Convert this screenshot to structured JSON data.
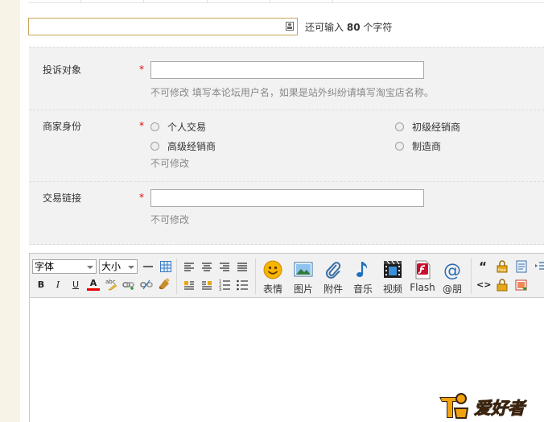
{
  "subject": {
    "value": "",
    "remaining_prefix": "还可输入",
    "remaining_count": "80",
    "remaining_suffix": "个字符"
  },
  "form": {
    "target": {
      "label": "投诉对象",
      "required_mark": "*",
      "value": "",
      "hint": "不可修改   填写本论坛用户名，如果是站外纠纷请填写淘宝店名称。"
    },
    "merchant": {
      "label": "商家身份",
      "required_mark": "*",
      "options": [
        "个人交易",
        "初级经销商",
        "高级经销商",
        "制造商"
      ],
      "hint": "不可修改"
    },
    "link": {
      "label": "交易链接",
      "required_mark": "*",
      "value": "",
      "hint": "不可修改"
    }
  },
  "editor": {
    "font_select": "字体",
    "size_select": "大小",
    "buttons": {
      "emoji": "表情",
      "image": "图片",
      "attachment": "附件",
      "music": "音乐",
      "video": "视频",
      "flash": "Flash",
      "mention": "@朋"
    },
    "format_labels": {
      "bold": "B",
      "italic": "I",
      "underline": "U",
      "font_color": "A",
      "quote": "“",
      "code": "<>"
    }
  },
  "watermark": {
    "text": "爱好者"
  },
  "colors": {
    "page_bg": "#f7f3e6",
    "form_bg": "#f2f2f2",
    "required": "#ee0000",
    "hint": "#888888",
    "subject_border": "#c8a65a"
  }
}
